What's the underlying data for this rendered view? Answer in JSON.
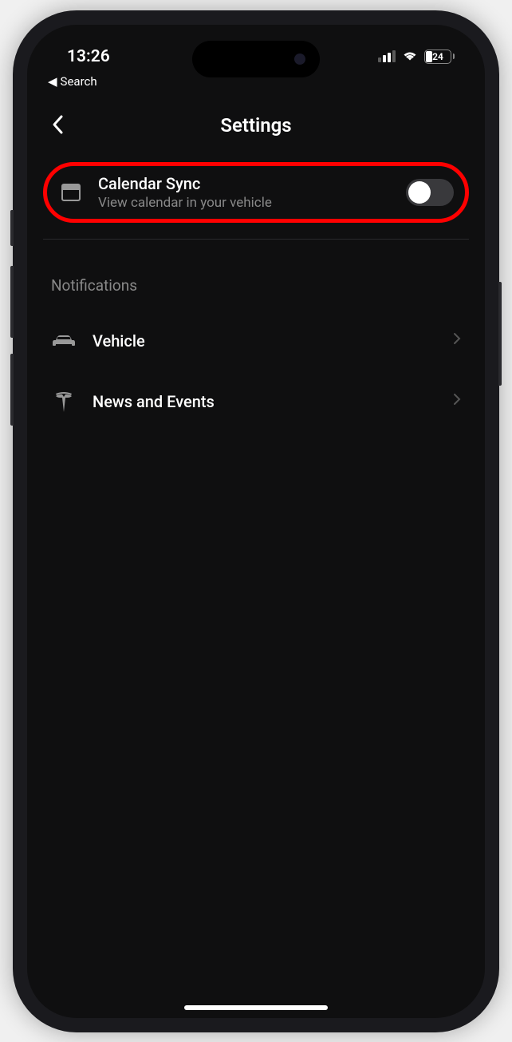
{
  "status_bar": {
    "time": "13:26",
    "battery_percent": "24"
  },
  "breadcrumb": {
    "label": "Search"
  },
  "header": {
    "title": "Settings"
  },
  "calendar_sync": {
    "title": "Calendar Sync",
    "subtitle": "View calendar in your vehicle",
    "enabled": false
  },
  "notifications": {
    "section_label": "Notifications",
    "items": [
      {
        "label": "Vehicle",
        "icon": "car-icon"
      },
      {
        "label": "News and Events",
        "icon": "tesla-icon"
      }
    ]
  }
}
